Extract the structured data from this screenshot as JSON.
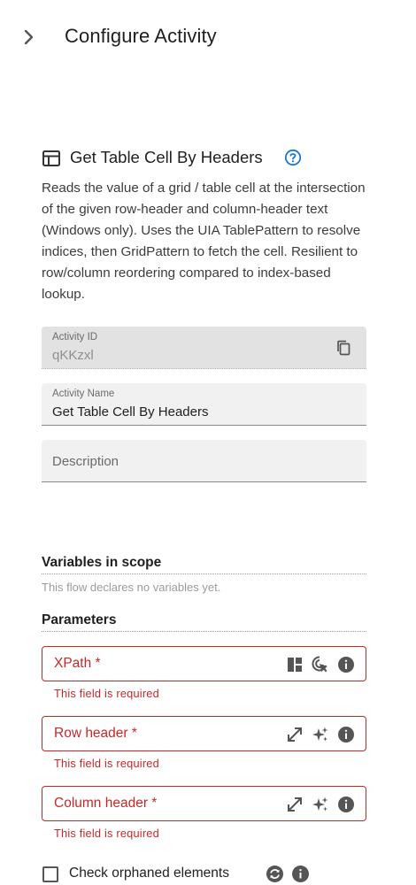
{
  "header": {
    "title": "Configure Activity"
  },
  "activity": {
    "title": "Get Table Cell By Headers",
    "description": "Reads the value of a grid / table cell at the intersection of the given row-header and column-header text (Windows only). Uses the UIA TablePattern to resolve indices, then GridPattern to fetch the cell. Resilient to row/column reordering compared to index-based lookup."
  },
  "fields": {
    "activity_id": {
      "label": "Activity ID",
      "value": "qKKzxl"
    },
    "activity_name": {
      "label": "Activity Name",
      "value": "Get Table Cell By Headers"
    },
    "description": {
      "placeholder": "Description"
    }
  },
  "variables": {
    "title": "Variables in scope",
    "empty_text": "This flow declares no variables yet."
  },
  "parameters": {
    "title": "Parameters",
    "items": [
      {
        "label": "XPath *",
        "error": "This field is required"
      },
      {
        "label": "Row header *",
        "error": "This field is required"
      },
      {
        "label": "Column header *",
        "error": "This field is required"
      }
    ]
  },
  "check_orphaned": {
    "label": "Check orphaned elements"
  },
  "colors": {
    "error": "#c62828",
    "accent": "#1976d2",
    "icon": "#555555"
  }
}
